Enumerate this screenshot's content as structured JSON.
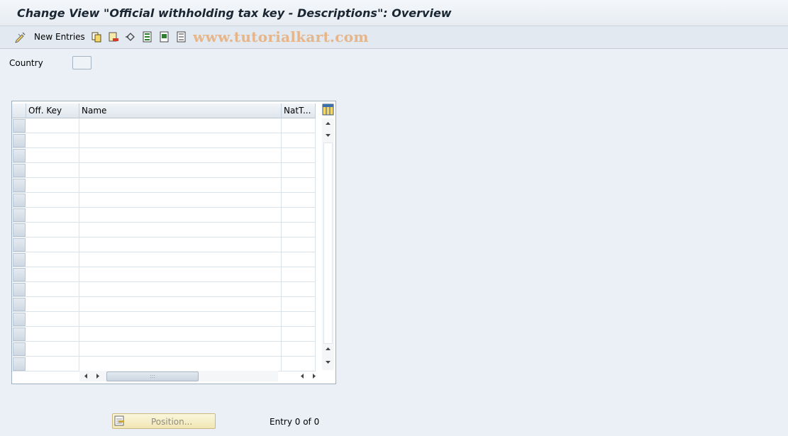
{
  "window": {
    "title": "Change View \"Official withholding tax key - Descriptions\": Overview"
  },
  "toolbar": {
    "new_entries_label": "New Entries",
    "buttons": [
      "edit-icon",
      "copy-icon",
      "delete-icon",
      "undo-icon",
      "select-all-icon",
      "select-block-icon",
      "deselect-all-icon"
    ],
    "watermark": "www.tutorialkart.com"
  },
  "filter": {
    "country_label": "Country",
    "country_value": ""
  },
  "table": {
    "columns": [
      "Off. Key",
      "Name",
      "NatT..."
    ],
    "visible_rows": 17,
    "rows": []
  },
  "footer": {
    "position_label": "Position...",
    "entry_count": "Entry 0 of 0"
  },
  "colors": {
    "background": "#eaf0f6",
    "toolbar": "#e2e9f0",
    "button_yellow": "#f1e6b4",
    "watermark": "#e6b58a"
  }
}
